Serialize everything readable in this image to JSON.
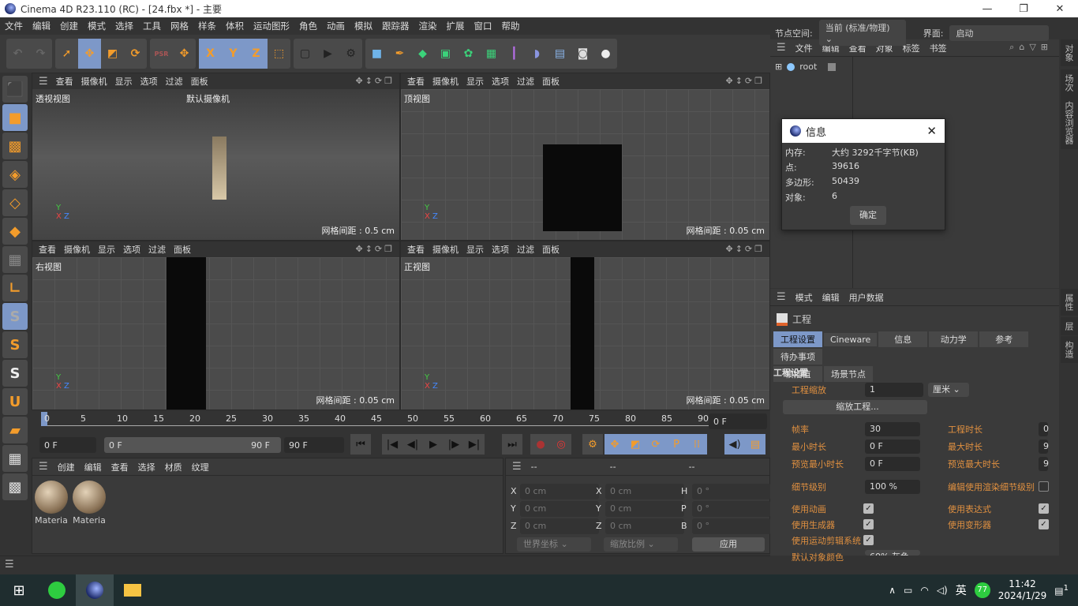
{
  "title": "Cinema 4D R23.110 (RC) - [24.fbx *] - 主要",
  "window_controls": [
    "—",
    "❐",
    "✕"
  ],
  "menu": [
    "文件",
    "编辑",
    "创建",
    "模式",
    "选择",
    "工具",
    "网格",
    "样条",
    "体积",
    "运动图形",
    "角色",
    "动画",
    "模拟",
    "跟踪器",
    "渲染",
    "扩展",
    "窗口",
    "帮助"
  ],
  "node_space": {
    "label": "节点空间:",
    "value": "当前 (标准/物理)"
  },
  "layout": {
    "label": "界面:",
    "value": "启动"
  },
  "toolbar_groups": [
    [
      {
        "icon": "undo-icon",
        "g": "↶",
        "c": "#666"
      },
      {
        "icon": "redo-icon",
        "g": "↷",
        "c": "#666"
      }
    ],
    [
      {
        "icon": "select-icon",
        "g": "➚",
        "c": "#f39c2b"
      },
      {
        "icon": "move-icon",
        "g": "✥",
        "c": "#f39c2b",
        "on": true
      },
      {
        "icon": "scale-icon",
        "g": "◩",
        "c": "#f39c2b"
      },
      {
        "icon": "rotate-icon",
        "g": "⟳",
        "c": "#f39c2b"
      }
    ],
    [
      {
        "icon": "psr-icon",
        "g": "PSR",
        "c": "#a55"
      },
      {
        "icon": "move-axis-icon",
        "g": "✥",
        "c": "#f39c2b"
      }
    ],
    [
      {
        "icon": "x-axis-icon",
        "g": "X",
        "c": "#f39c2b",
        "on": true
      },
      {
        "icon": "y-axis-icon",
        "g": "Y",
        "c": "#f39c2b",
        "on": true
      },
      {
        "icon": "z-axis-icon",
        "g": "Z",
        "c": "#f39c2b",
        "on": true
      },
      {
        "icon": "coordinate-system-icon",
        "g": "⬚",
        "c": "#f39c2b"
      }
    ],
    [
      {
        "icon": "render-view-icon",
        "g": "▢",
        "c": "#222"
      },
      {
        "icon": "render-picture-viewer-icon",
        "g": "▶",
        "c": "#222"
      },
      {
        "icon": "render-settings-icon",
        "g": "⚙",
        "c": "#222"
      }
    ],
    [
      {
        "icon": "cube-icon",
        "g": "■",
        "c": "#6fb3e8"
      },
      {
        "icon": "pen-icon",
        "g": "✒",
        "c": "#f39c2b"
      },
      {
        "icon": "subdivision-icon",
        "g": "◆",
        "c": "#3bd37a"
      },
      {
        "icon": "extrude-icon",
        "g": "▣",
        "c": "#3bd37a"
      },
      {
        "icon": "cloner-icon",
        "g": "✿",
        "c": "#3bd37a"
      },
      {
        "icon": "mograph-icon",
        "g": "▦",
        "c": "#3bd37a"
      },
      {
        "icon": "deformer-icon",
        "g": "┃",
        "c": "#b66ee8"
      },
      {
        "icon": "field-icon",
        "g": "◗",
        "c": "#8a95e0"
      },
      {
        "icon": "floor-icon",
        "g": "▤",
        "c": "#8ab4e8"
      },
      {
        "icon": "camera-icon",
        "g": "◙",
        "c": "#ddd"
      },
      {
        "icon": "light-icon",
        "g": "●",
        "c": "#eee"
      }
    ]
  ],
  "left_tools": [
    {
      "icon": "make-editable-icon",
      "g": "⬛",
      "c": "#888"
    },
    {
      "icon": "model-mode-icon",
      "g": "■",
      "c": "#f39c2b",
      "on": true
    },
    {
      "icon": "texture-mode-icon",
      "g": "▩",
      "c": "#f39c2b"
    },
    {
      "icon": "points-mode-icon",
      "g": "◈",
      "c": "#f39c2b"
    },
    {
      "icon": "edges-mode-icon",
      "g": "◇",
      "c": "#f39c2b"
    },
    {
      "icon": "polygons-mode-icon",
      "g": "◆",
      "c": "#f39c2b"
    },
    {
      "icon": "uv-mode-icon",
      "g": "▦",
      "c": "#888"
    },
    {
      "icon": "axis-mode-icon",
      "g": "∟",
      "c": "#f39c2b"
    },
    {
      "icon": "snap-s1-icon",
      "g": "S",
      "c": "#aaa",
      "on": true
    },
    {
      "icon": "snap-s2-icon",
      "g": "S",
      "c": "#f39c2b"
    },
    {
      "icon": "snap-s3-icon",
      "g": "S",
      "c": "#eee"
    },
    {
      "icon": "magnet-icon",
      "g": "U",
      "c": "#f39c2b"
    },
    {
      "icon": "workplane-icon",
      "g": "▰",
      "c": "#f39c2b"
    },
    {
      "icon": "lock-workplane-icon",
      "g": "▦",
      "c": "#ddd"
    },
    {
      "icon": "grid-icon",
      "g": "▩",
      "c": "#ddd"
    }
  ],
  "viewport_menu": [
    "查看",
    "摄像机",
    "显示",
    "选项",
    "过滤",
    "面板"
  ],
  "viewports": [
    {
      "name": "透视视图",
      "camera": "默认摄像机",
      "grid": ""
    },
    {
      "name": "顶视图",
      "grid": "网格间距 : 0.05 cm"
    },
    {
      "name": "右视图",
      "grid": "网格间距 : 0.05 cm"
    },
    {
      "name": "正视图",
      "grid": "网格间距 : 0.05 cm"
    }
  ],
  "persp_grid": "网格间距 : 0.5 cm",
  "timeline": {
    "ticks": [
      0,
      5,
      10,
      15,
      20,
      25,
      30,
      35,
      40,
      45,
      50,
      55,
      60,
      65,
      70,
      75,
      80,
      85,
      90
    ],
    "current": "0 F",
    "start": "0 F",
    "range_start": "0 F",
    "range_end": "90 F",
    "end": "90 F",
    "current_frame_right": "0 F"
  },
  "playback": [
    "⏮",
    "|◀",
    "◀|",
    "▶",
    "|▶",
    "▶|",
    "⏭"
  ],
  "material_menu": [
    "创建",
    "编辑",
    "查看",
    "选择",
    "材质",
    "纹理"
  ],
  "materials": [
    "Materia",
    "Materia"
  ],
  "coords": {
    "headers": [
      "--",
      "--",
      "--"
    ],
    "pos": [
      [
        "X",
        "0 cm"
      ],
      [
        "Y",
        "0 cm"
      ],
      [
        "Z",
        "0 cm"
      ]
    ],
    "size": [
      [
        "X",
        "0 cm"
      ],
      [
        "Y",
        "0 cm"
      ],
      [
        "Z",
        "0 cm"
      ]
    ],
    "rot": [
      [
        "H",
        "0 °"
      ],
      [
        "P",
        "0 °"
      ],
      [
        "B",
        "0 °"
      ]
    ],
    "mode1": "世界坐标",
    "mode2": "缩放比例",
    "apply": "应用"
  },
  "object_manager": {
    "menu": [
      "文件",
      "编辑",
      "查看",
      "对象",
      "标签",
      "书签"
    ],
    "root": "root",
    "side_tabs": [
      "对象",
      "场次",
      "内容浏览器"
    ]
  },
  "info_dialog": {
    "title": "信息",
    "rows": [
      [
        "内存:",
        "大约 3292千字节(KB)"
      ],
      [
        "点:",
        "39616"
      ],
      [
        "多边形:",
        "50439"
      ],
      [
        "对象:",
        "6"
      ]
    ],
    "ok": "确定"
  },
  "attributes": {
    "menu": [
      "模式",
      "编辑",
      "用户数据"
    ],
    "object": "工程",
    "tabs": [
      "工程设置",
      "Cineware",
      "信息",
      "动力学",
      "参考",
      "待办事项"
    ],
    "tabs2": [
      "帧插值",
      "场景节点"
    ],
    "section": "工程设置",
    "scale_label": "工程缩放",
    "scale_value": "1",
    "scale_unit": "厘米",
    "scale_button": "缩放工程...",
    "fps_label": "帧率",
    "fps": "30",
    "duration_label": "工程时长",
    "duration": "0",
    "min_label": "最小时长",
    "min": "0 F",
    "max_label": "最大时长",
    "max": "9",
    "pmin_label": "预览最小时长",
    "pmin": "0 F",
    "pmax_label": "预览最大时长",
    "pmax": "9",
    "lod_label": "细节级别",
    "lod": "100 %",
    "render_lod_label": "编辑使用渲染细节级别",
    "checks": [
      {
        "label": "使用动画",
        "checked": true
      },
      {
        "label": "使用表达式",
        "checked": true
      },
      {
        "label": "使用生成器",
        "checked": true
      },
      {
        "label": "使用变形器",
        "checked": true
      },
      {
        "label": "使用运动剪辑系统",
        "checked": true
      }
    ],
    "color_label": "默认对象颜色",
    "color_value": "60% 灰色",
    "side_tabs": [
      "属性",
      "层",
      "构造"
    ]
  },
  "taskbar": {
    "time": "11:42",
    "date": "2024/1/29",
    "ime": "英",
    "badge": "77",
    "notif": "1"
  },
  "colors": {
    "accent": "#7d98c8",
    "label_orange": "#e09040"
  }
}
